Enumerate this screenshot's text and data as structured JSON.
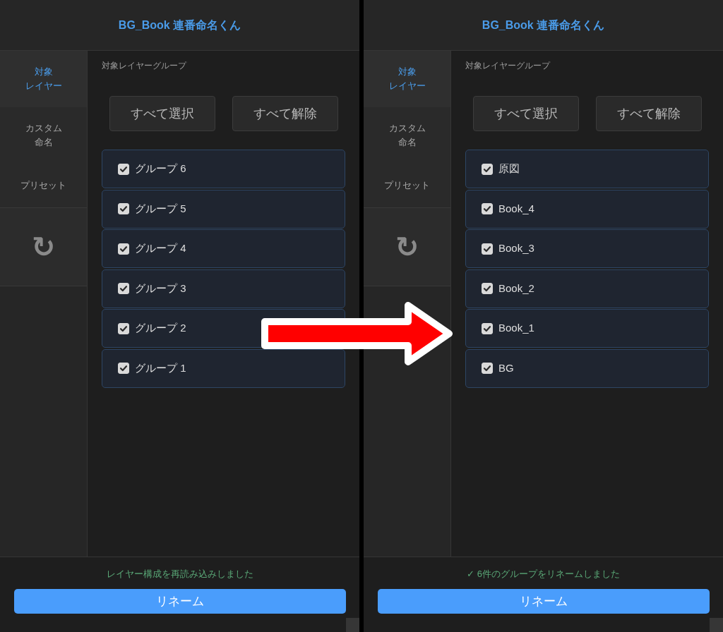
{
  "panels": [
    {
      "title": "BG_Book 連番命名くん",
      "tabs": [
        {
          "lines": [
            "対象",
            "レイヤー"
          ],
          "selected": true
        },
        {
          "lines": [
            "カスタム",
            "命名"
          ],
          "selected": false
        },
        {
          "lines": [
            "プリセット"
          ],
          "selected": false
        }
      ],
      "refresh": "↻",
      "section_label": "対象レイヤーグループ",
      "buttons": [
        "すべて選択",
        "すべて解除"
      ],
      "groups": [
        {
          "name": "グループ 6",
          "checked": true
        },
        {
          "name": "グループ 5",
          "checked": true
        },
        {
          "name": "グループ 4",
          "checked": true
        },
        {
          "name": "グループ 3",
          "checked": true
        },
        {
          "name": "グループ 2",
          "checked": true
        },
        {
          "name": "グループ 1",
          "checked": true
        }
      ],
      "status": "レイヤー構成を再読み込みしました",
      "action": "リネーム"
    },
    {
      "title": "BG_Book 連番命名くん",
      "tabs": [
        {
          "lines": [
            "対象",
            "レイヤー"
          ],
          "selected": true
        },
        {
          "lines": [
            "カスタム",
            "命名"
          ],
          "selected": false
        },
        {
          "lines": [
            "プリセット"
          ],
          "selected": false
        }
      ],
      "refresh": "↻",
      "section_label": "対象レイヤーグループ",
      "buttons": [
        "すべて選択",
        "すべて解除"
      ],
      "groups": [
        {
          "name": "原図",
          "checked": true
        },
        {
          "name": "Book_4",
          "checked": true
        },
        {
          "name": "Book_3",
          "checked": true
        },
        {
          "name": "Book_2",
          "checked": true
        },
        {
          "name": "Book_1",
          "checked": true
        },
        {
          "name": "BG",
          "checked": true
        }
      ],
      "status": "✓ 6件のグループをリネームしました",
      "action": "リネーム"
    }
  ]
}
